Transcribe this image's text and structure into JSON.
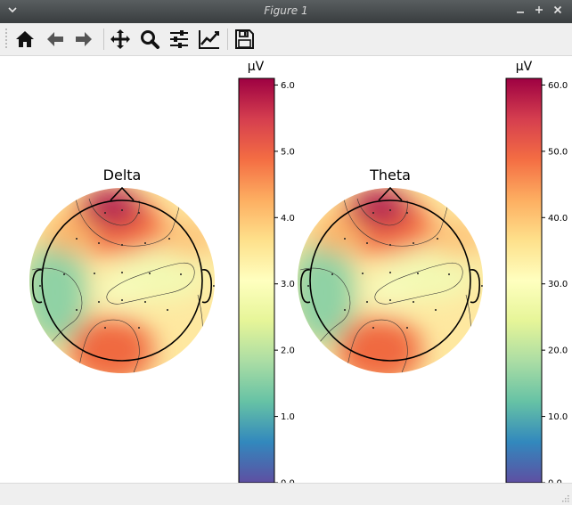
{
  "window": {
    "title": "Figure 1",
    "menu_icon": "chevron-down-icon",
    "minimize_icon": "minimize-icon",
    "maximize_icon": "maximize-icon",
    "close_icon": "close-icon"
  },
  "toolbar": {
    "tools": [
      {
        "name": "home-icon"
      },
      {
        "name": "back-arrow-icon"
      },
      {
        "name": "forward-arrow-icon"
      },
      {
        "name": "pan-icon"
      },
      {
        "name": "zoom-icon"
      },
      {
        "name": "subplots-config-icon"
      },
      {
        "name": "edit-axis-icon"
      },
      {
        "name": "save-icon"
      }
    ]
  },
  "chart_data": [
    {
      "type": "heatmap",
      "subtype": "eeg-topomap",
      "title": "Delta",
      "colorbar": {
        "label": "µV",
        "range": [
          0,
          6.1
        ],
        "ticks": [
          0.0,
          1.0,
          2.0,
          3.0,
          4.0,
          5.0,
          6.0
        ],
        "tick_labels": [
          "0.0",
          "1.0",
          "2.0",
          "3.0",
          "4.0",
          "5.0",
          "6.0"
        ],
        "colormap": "Spectral_r"
      },
      "regions": [
        {
          "location": "frontal-midline",
          "value": 6.0
        },
        {
          "location": "left-posterior",
          "value": 5.0
        },
        {
          "location": "left-temporal",
          "value": 2.2
        },
        {
          "location": "right-central",
          "value": 2.9
        },
        {
          "location": "right-frontal",
          "value": 4.0
        }
      ]
    },
    {
      "type": "heatmap",
      "subtype": "eeg-topomap",
      "title": "Theta",
      "colorbar": {
        "label": "µV",
        "range": [
          0,
          61
        ],
        "ticks": [
          0.0,
          10.0,
          20.0,
          30.0,
          40.0,
          50.0,
          60.0
        ],
        "tick_labels": [
          "0.0",
          "10.0",
          "20.0",
          "30.0",
          "40.0",
          "50.0",
          "60.0"
        ],
        "colormap": "Spectral_r"
      },
      "regions": [
        {
          "location": "frontal-midline",
          "value": 60.0
        },
        {
          "location": "left-posterior",
          "value": 50.0
        },
        {
          "location": "left-temporal",
          "value": 22.0
        },
        {
          "location": "right-central",
          "value": 29.0
        },
        {
          "location": "right-frontal",
          "value": 40.0
        }
      ]
    }
  ]
}
